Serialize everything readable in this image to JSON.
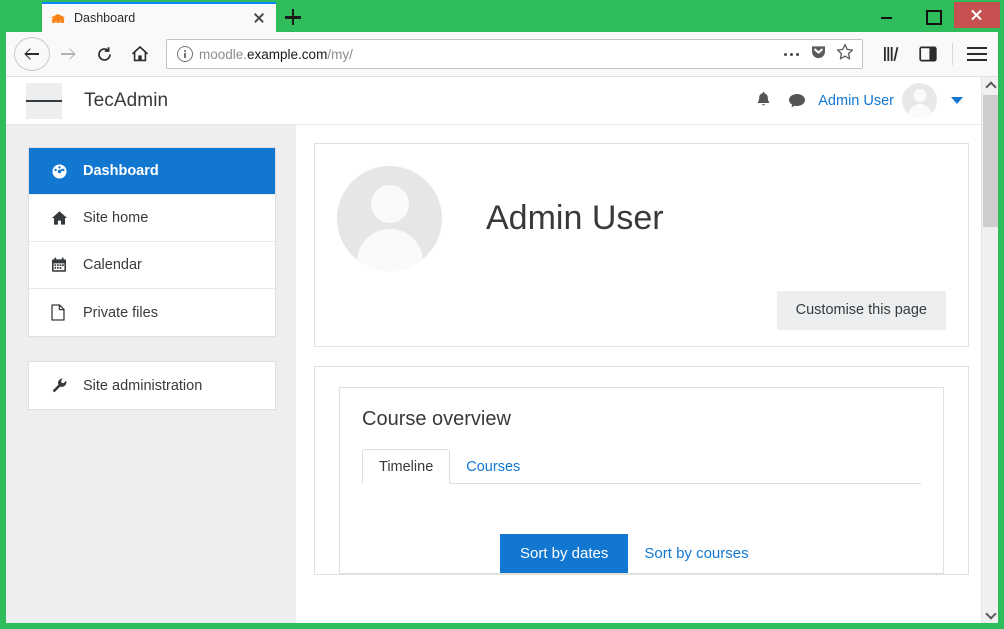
{
  "browser": {
    "tab": {
      "title": "Dashboard",
      "favicon": "moodle-logo-icon",
      "close_label": "Close tab"
    },
    "new_tab_label": "New tab",
    "window_controls": {
      "minimize": "Minimize",
      "maximize": "Maximize",
      "close": "Close"
    },
    "toolbar": {
      "back": "Back",
      "forward": "Forward",
      "reload": "Reload",
      "home": "Home",
      "url_prefix": "moodle.",
      "url_domain": "example.com",
      "url_path": "/my/",
      "page_actions": "Page actions",
      "pocket": "Save to Pocket",
      "bookmark": "Bookmark this page",
      "library": "Library",
      "sidebar": "Sidebars",
      "menu": "Open menu"
    }
  },
  "site": {
    "navbar": {
      "toggle_label": "Side panel",
      "brand": "TecAdmin",
      "notifications": "Notifications",
      "messages": "Messages",
      "username": "Admin User",
      "caret": "User menu"
    },
    "sidebar": {
      "groups": [
        {
          "items": [
            {
              "label": "Dashboard",
              "icon": "tachometer-icon",
              "active": true
            },
            {
              "label": "Site home",
              "icon": "home-icon",
              "active": false
            },
            {
              "label": "Calendar",
              "icon": "calendar-icon",
              "active": false
            },
            {
              "label": "Private files",
              "icon": "file-icon",
              "active": false
            }
          ]
        },
        {
          "items": [
            {
              "label": "Site administration",
              "icon": "wrench-icon",
              "active": false
            }
          ]
        }
      ]
    },
    "profile": {
      "name": "Admin User",
      "avatar": "user-avatar-placeholder",
      "customise_button": "Customise this page"
    },
    "course_overview": {
      "title": "Course overview",
      "tabs": [
        {
          "label": "Timeline",
          "active": true
        },
        {
          "label": "Courses",
          "active": false
        }
      ],
      "sort_buttons": [
        {
          "label": "Sort by dates",
          "active": true
        },
        {
          "label": "Sort by courses",
          "active": false
        }
      ]
    }
  },
  "colors": {
    "accent_blue": "#1177d1",
    "window_green": "#2ebd5a",
    "tab_accent": "#0a84ff",
    "sidebar_gray": "#eceeef",
    "close_red": "#c75050"
  }
}
